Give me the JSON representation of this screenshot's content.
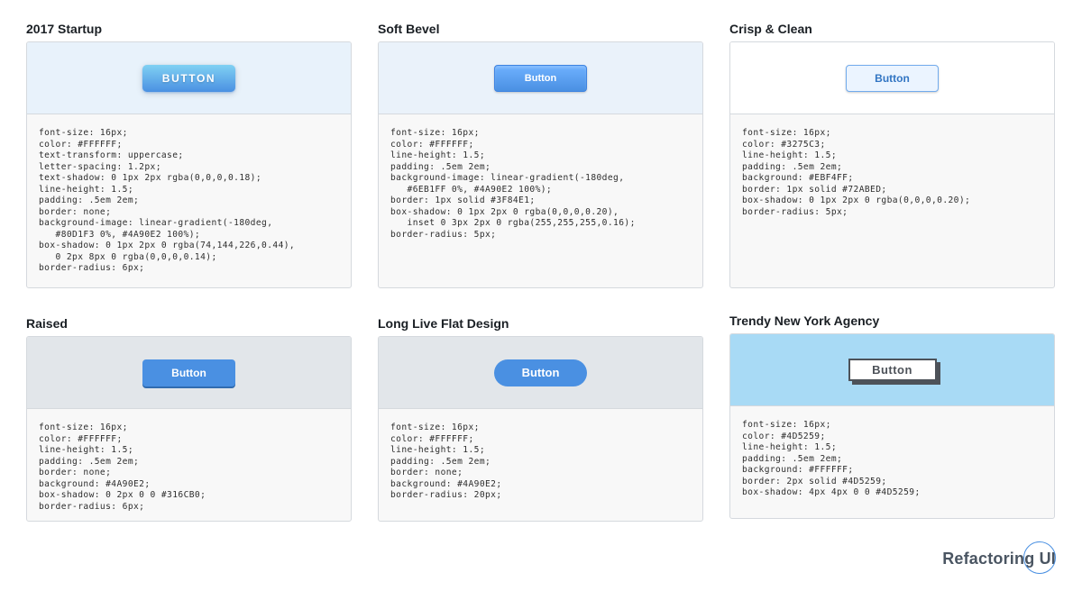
{
  "cards": [
    {
      "title": "2017 Startup",
      "button_label": "Button",
      "preview_bg": "#E8F2FB",
      "code": "font-size: 16px;\ncolor: #FFFFFF;\ntext-transform: uppercase;\nletter-spacing: 1.2px;\ntext-shadow: 0 1px 2px rgba(0,0,0,0.18);\nline-height: 1.5;\npadding: .5em 2em;\nborder: none;\nbackground-image: linear-gradient(-180deg,\n   #80D1F3 0%, #4A90E2 100%);\nbox-shadow: 0 1px 2px 0 rgba(74,144,226,0.44),\n   0 2px 8px 0 rgba(0,0,0,0.14);\nborder-radius: 6px;"
    },
    {
      "title": "Soft Bevel",
      "button_label": "Button",
      "preview_bg": "#EAF2FA",
      "code": "font-size: 16px;\ncolor: #FFFFFF;\nline-height: 1.5;\npadding: .5em 2em;\nbackground-image: linear-gradient(-180deg,\n   #6EB1FF 0%, #4A90E2 100%);\nborder: 1px solid #3F84E1;\nbox-shadow: 0 1px 2px 0 rgba(0,0,0,0.20),\n   inset 0 3px 2px 0 rgba(255,255,255,0.16);\nborder-radius: 5px;"
    },
    {
      "title": "Crisp & Clean",
      "button_label": "Button",
      "preview_bg": "#FFFFFF",
      "code": "font-size: 16px;\ncolor: #3275C3;\nline-height: 1.5;\npadding: .5em 2em;\nbackground: #EBF4FF;\nborder: 1px solid #72ABED;\nbox-shadow: 0 1px 2px 0 rgba(0,0,0,0.20);\nborder-radius: 5px;"
    },
    {
      "title": "Raised",
      "button_label": "Button",
      "preview_bg": "#E2E6EA",
      "code": "font-size: 16px;\ncolor: #FFFFFF;\nline-height: 1.5;\npadding: .5em 2em;\nborder: none;\nbackground: #4A90E2;\nbox-shadow: 0 2px 0 0 #316CB0;\nborder-radius: 6px;"
    },
    {
      "title": "Long Live Flat Design",
      "button_label": "Button",
      "preview_bg": "#E2E6EA",
      "code": "font-size: 16px;\ncolor: #FFFFFF;\nline-height: 1.5;\npadding: .5em 2em;\nborder: none;\nbackground: #4A90E2;\nborder-radius: 20px;"
    },
    {
      "title": "Trendy New York Agency",
      "button_label": "Button",
      "preview_bg": "#A8DAF5",
      "code": "font-size: 16px;\ncolor: #4D5259;\nline-height: 1.5;\npadding: .5em 2em;\nbackground: #FFFFFF;\nborder: 2px solid #4D5259;\nbox-shadow: 4px 4px 0 0 #4D5259;"
    }
  ],
  "logo": {
    "text": "Refactoring UI"
  }
}
